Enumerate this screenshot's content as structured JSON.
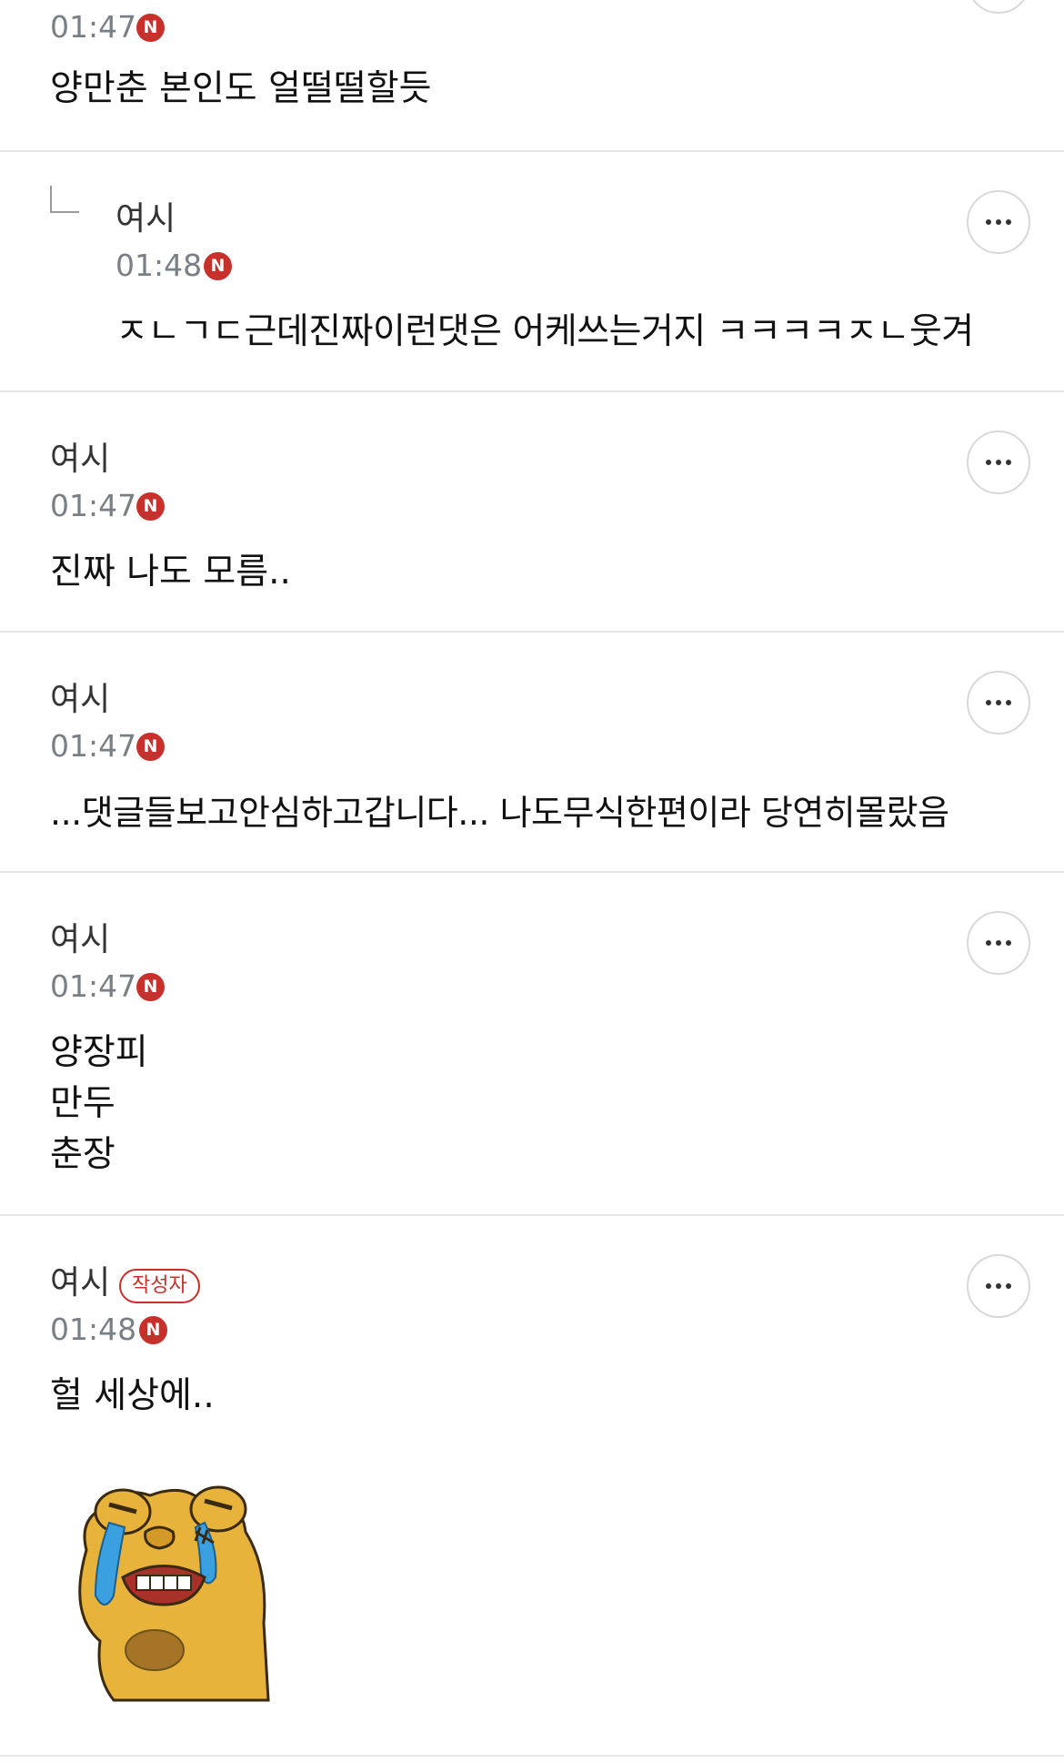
{
  "comments": [
    {
      "time": "01:47",
      "badge": "N",
      "body": "양만춘 본인도 얼떨떨할듯"
    },
    {
      "author": "여시",
      "time": "01:48",
      "badge": "N",
      "body": "ㅈㄴㄱㄷ근데진짜이런댓은 어케쓰는거지 ㅋㅋㅋㅋㅈㄴ웃겨"
    },
    {
      "author": "여시",
      "time": "01:47",
      "badge": "N",
      "body": "진짜 나도 모름.."
    },
    {
      "author": "여시",
      "time": "01:47",
      "badge": "N",
      "body": "...댓글들보고안심하고갑니다... 나도무식한편이라 당연히몰랐음"
    },
    {
      "author": "여시",
      "time": "01:47",
      "badge": "N",
      "lines": [
        "양장피",
        "만두",
        "춘장"
      ]
    },
    {
      "author": "여시",
      "writer_tag": "작성자",
      "time": "01:48",
      "badge": "N",
      "body": "헐 세상에.."
    }
  ],
  "sticker": {
    "description": "crying-bear-sticker"
  },
  "colors": {
    "badge": "#c8302c",
    "divider": "#e6e6e6",
    "time": "#7a7f86"
  }
}
